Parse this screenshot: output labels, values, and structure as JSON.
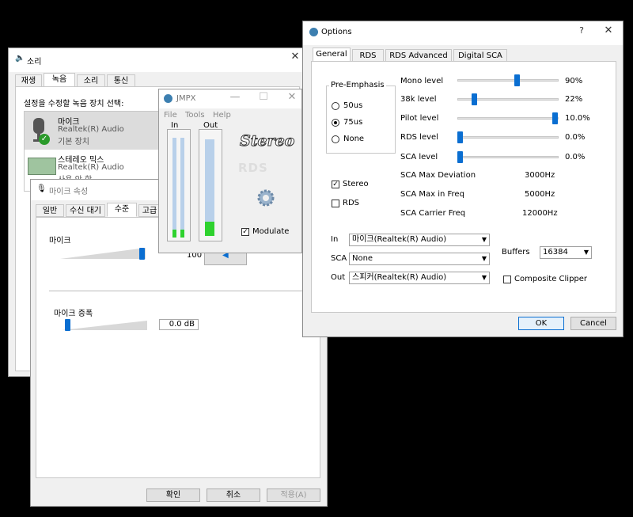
{
  "sound": {
    "title": "소리",
    "tabs": [
      "재생",
      "녹음",
      "소리",
      "통신"
    ],
    "instruction": "설정을 수정할 녹음 장치 선택:",
    "devices": [
      {
        "name": "마이크",
        "driver": "Realtek(R) Audio",
        "status": "기본 장치"
      },
      {
        "name": "스테레오 믹스",
        "driver": "Realtek(R) Audio",
        "status": "사용 안 함"
      }
    ]
  },
  "mic_props": {
    "title": "마이크 속성",
    "tabs": [
      "일반",
      "수신 대기",
      "수준",
      "고급"
    ],
    "mic_label": "마이크",
    "mic_value": "100",
    "mic_level": 1.0,
    "boost_label": "마이크 증폭",
    "boost_value": "0.0 dB",
    "boost_level": 0.0,
    "ok": "확인",
    "cancel": "취소",
    "apply": "적용(A)"
  },
  "jmpx": {
    "title": "JMPX",
    "menu": [
      "File",
      "Tools",
      "Help"
    ],
    "in_label": "In",
    "out_label": "Out",
    "logo_stereo": "Stereo",
    "logo_rds": "RDS",
    "modulate_label": "Modulate",
    "modulate_checked": true
  },
  "options": {
    "title": "Options",
    "help": "?",
    "close": "✕",
    "tabs": [
      "General",
      "RDS",
      "RDS Advanced",
      "Digital SCA"
    ],
    "pre_emphasis_title": "Pre-Emphasis",
    "pre_emphasis_options": [
      "50us",
      "75us",
      "None"
    ],
    "pre_emphasis_selected": "75us",
    "stereo_label": "Stereo",
    "stereo_checked": true,
    "rds_label": "RDS",
    "rds_checked": false,
    "levels": [
      {
        "label": "Mono level",
        "value": "90%",
        "level": 0.9
      },
      {
        "label": "38k level",
        "value": "22%",
        "level": 0.22
      },
      {
        "label": "Pilot level",
        "value": "10.0%",
        "level": 1.0
      },
      {
        "label": "RDS level",
        "value": "0.0%",
        "level": 0.0
      },
      {
        "label": "SCA level",
        "value": "0.0%",
        "level": 0.0
      }
    ],
    "sca_info": [
      {
        "label": "SCA Max Deviation",
        "value": "3000Hz"
      },
      {
        "label": "SCA Max in Freq",
        "value": "5000Hz"
      },
      {
        "label": "SCA Carrier Freq",
        "value": "12000Hz"
      }
    ],
    "in_label": "In",
    "in_value": "마이크(Realtek(R) Audio)",
    "sca_label": "SCA",
    "sca_value": "None",
    "out_label": "Out",
    "out_value": "스피커(Realtek(R) Audio)",
    "buffers_label": "Buffers",
    "buffers_value": "16384",
    "composite_clipper_label": "Composite Clipper",
    "composite_clipper_checked": false,
    "ok": "OK",
    "cancel": "Cancel",
    "accent": "#0a6ed1"
  }
}
